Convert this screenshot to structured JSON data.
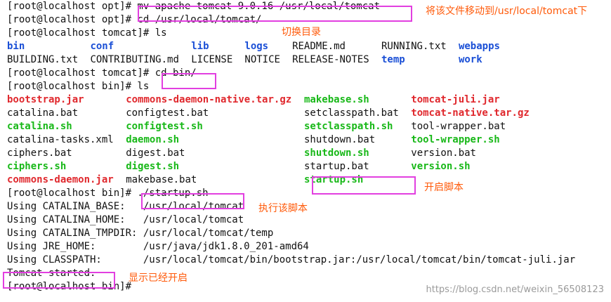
{
  "colors": {
    "directory": "#1a4fd6",
    "archive": "#e0282d",
    "executable": "#18b818",
    "annotation_box": "#e23fe0",
    "annotation_text": "#ff5a0a"
  },
  "terminal": {
    "lines": [
      {
        "text": "[root@localhost opt]# mv apache-tomcat-9.0.16 /usr/local/tomcat"
      },
      {
        "text": "[root@localhost opt]# cd /usr/local/tomcat/"
      },
      {
        "text": "[root@localhost tomcat]# ls"
      },
      {
        "cells": [
          {
            "text": "bin",
            "col": 0,
            "type": "directory"
          },
          {
            "text": "conf",
            "col": 14,
            "type": "directory"
          },
          {
            "text": "lib",
            "col": 31,
            "type": "directory"
          },
          {
            "text": "logs",
            "col": 40,
            "type": "directory"
          },
          {
            "text": "README.md",
            "col": 48,
            "type": "plain"
          },
          {
            "text": "RUNNING.txt",
            "col": 63,
            "type": "plain"
          },
          {
            "text": "webapps",
            "col": 76,
            "type": "directory"
          }
        ]
      },
      {
        "cells": [
          {
            "text": "BUILDING.txt",
            "col": 0,
            "type": "plain"
          },
          {
            "text": "CONTRIBUTING.md",
            "col": 14,
            "type": "plain"
          },
          {
            "text": "LICENSE",
            "col": 31,
            "type": "plain"
          },
          {
            "text": "NOTICE",
            "col": 40,
            "type": "plain"
          },
          {
            "text": "RELEASE-NOTES",
            "col": 48,
            "type": "plain"
          },
          {
            "text": "temp",
            "col": 63,
            "type": "directory"
          },
          {
            "text": "work",
            "col": 76,
            "type": "directory"
          }
        ]
      },
      {
        "text": "[root@localhost tomcat]# cd bin/"
      },
      {
        "text": "[root@localhost bin]# ls"
      },
      {
        "cells": [
          {
            "text": "bootstrap.jar",
            "col": 0,
            "type": "archive"
          },
          {
            "text": "commons-daemon-native.tar.gz",
            "col": 20,
            "type": "archive"
          },
          {
            "text": "makebase.sh",
            "col": 50,
            "type": "executable"
          },
          {
            "text": "tomcat-juli.jar",
            "col": 68,
            "type": "archive"
          }
        ]
      },
      {
        "cells": [
          {
            "text": "catalina.bat",
            "col": 0,
            "type": "plain"
          },
          {
            "text": "configtest.bat",
            "col": 20,
            "type": "plain"
          },
          {
            "text": "setclasspath.bat",
            "col": 50,
            "type": "plain"
          },
          {
            "text": "tomcat-native.tar.gz",
            "col": 68,
            "type": "archive"
          }
        ]
      },
      {
        "cells": [
          {
            "text": "catalina.sh",
            "col": 0,
            "type": "executable"
          },
          {
            "text": "configtest.sh",
            "col": 20,
            "type": "executable"
          },
          {
            "text": "setclasspath.sh",
            "col": 50,
            "type": "executable"
          },
          {
            "text": "tool-wrapper.bat",
            "col": 68,
            "type": "plain"
          }
        ]
      },
      {
        "cells": [
          {
            "text": "catalina-tasks.xml",
            "col": 0,
            "type": "plain"
          },
          {
            "text": "daemon.sh",
            "col": 20,
            "type": "executable"
          },
          {
            "text": "shutdown.bat",
            "col": 50,
            "type": "plain"
          },
          {
            "text": "tool-wrapper.sh",
            "col": 68,
            "type": "executable"
          }
        ]
      },
      {
        "cells": [
          {
            "text": "ciphers.bat",
            "col": 0,
            "type": "plain"
          },
          {
            "text": "digest.bat",
            "col": 20,
            "type": "plain"
          },
          {
            "text": "shutdown.sh",
            "col": 50,
            "type": "executable"
          },
          {
            "text": "version.bat",
            "col": 68,
            "type": "plain"
          }
        ]
      },
      {
        "cells": [
          {
            "text": "ciphers.sh",
            "col": 0,
            "type": "executable"
          },
          {
            "text": "digest.sh",
            "col": 20,
            "type": "executable"
          },
          {
            "text": "startup.bat",
            "col": 50,
            "type": "plain"
          },
          {
            "text": "version.sh",
            "col": 68,
            "type": "executable"
          }
        ]
      },
      {
        "cells": [
          {
            "text": "commons-daemon.jar",
            "col": 0,
            "type": "archive"
          },
          {
            "text": "makebase.bat",
            "col": 20,
            "type": "plain"
          },
          {
            "text": "startup.sh",
            "col": 50,
            "type": "executable"
          }
        ]
      },
      {
        "text": "[root@localhost bin]# ./startup.sh"
      },
      {
        "text": "Using CATALINA_BASE:   /usr/local/tomcat"
      },
      {
        "text": "Using CATALINA_HOME:   /usr/local/tomcat"
      },
      {
        "text": "Using CATALINA_TMPDIR: /usr/local/tomcat/temp"
      },
      {
        "text": "Using JRE_HOME:        /usr/java/jdk1.8.0_201-amd64"
      },
      {
        "text": "Using CLASSPATH:       /usr/local/tomcat/bin/bootstrap.jar:/usr/local/tomcat/bin/tomcat-juli.jar"
      },
      {
        "text": "Tomcat started."
      },
      {
        "text": "[root@localhost bin]# "
      }
    ]
  },
  "annotations": {
    "move_note": "将该文件移动到/usr/local/tomcat下",
    "cd_note": "切换目录",
    "startup_note": "开启脚本",
    "run_note": "执行该脚本",
    "started_note": "显示已经开启"
  },
  "watermark": "https://blog.csdn.net/weixin_56508123"
}
